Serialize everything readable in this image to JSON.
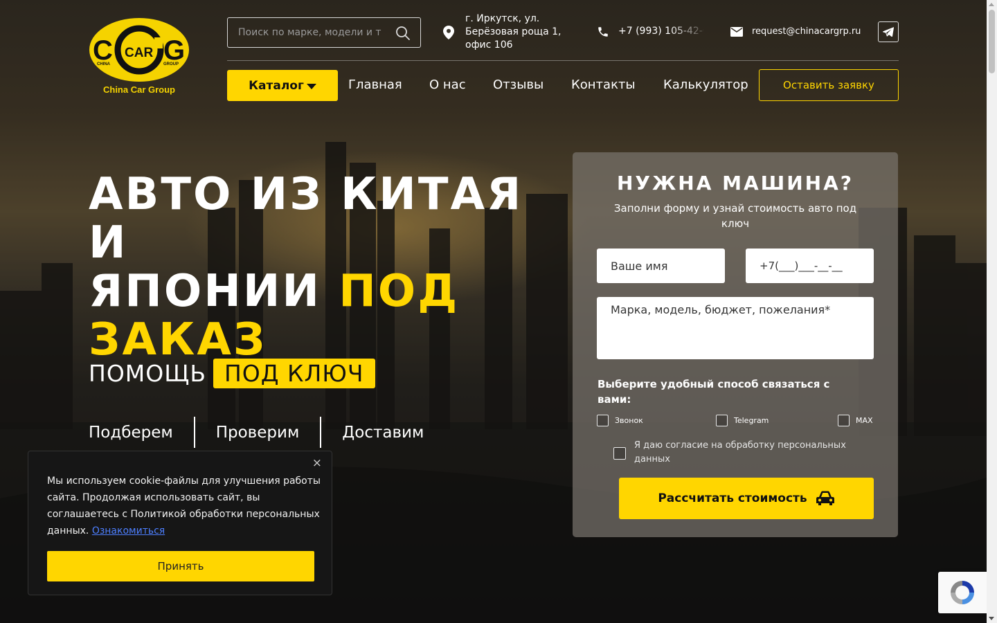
{
  "header": {
    "logo_caption": "China Car Group",
    "search_placeholder": "Поиск по марке, модели и т",
    "address_lines": [
      "г. Иркутск, ул.",
      "Берёзовая роща 1,",
      "офис 106"
    ],
    "phone": "+7 (993) 105-42-0",
    "email": "request@chinacargrp.ru"
  },
  "nav": {
    "catalog_label": "Каталог",
    "items": [
      "Главная",
      "О нас",
      "Отзывы",
      "Контакты",
      "Калькулятор"
    ],
    "request_label": "Оставить заявку"
  },
  "hero": {
    "title_line1": "Авто из Китая и",
    "title_line2a": "Японии ",
    "title_line2b": "под",
    "title_line3": "заказ",
    "help_plain": "ПОМОЩЬ",
    "help_badge": "ПОД КЛЮЧ",
    "steps": [
      "Подберем",
      "Проверим",
      "Доставим"
    ]
  },
  "form": {
    "title": "НУЖНА МАШИНА?",
    "subtitle": "Заполни форму и узнай стоимость авто под ключ",
    "name_placeholder": "Ваше имя",
    "phone_placeholder": "+7(___)___-__-__",
    "wish_placeholder": "Марка, модель, бюджет, пожелания*",
    "contact_prompt": "Выберите удобный способ связаться с вами:",
    "contact_options": [
      "Звонок",
      "Telegram",
      "MAX"
    ],
    "consent": "Я даю согласие на обработку персональных данных",
    "submit_label": "Рассчитать стоимость"
  },
  "cookie": {
    "message": "Мы используем cookie-файлы для улучшения работы сайта. Продолжая использовать сайт, вы соглашаетесь с Политикой обработки персональных данных. ",
    "link": "Ознакомиться",
    "accept_label": "Принять",
    "close_glyph": "×"
  },
  "colors": {
    "accent": "#ffd600",
    "link": "#4d7fff"
  }
}
